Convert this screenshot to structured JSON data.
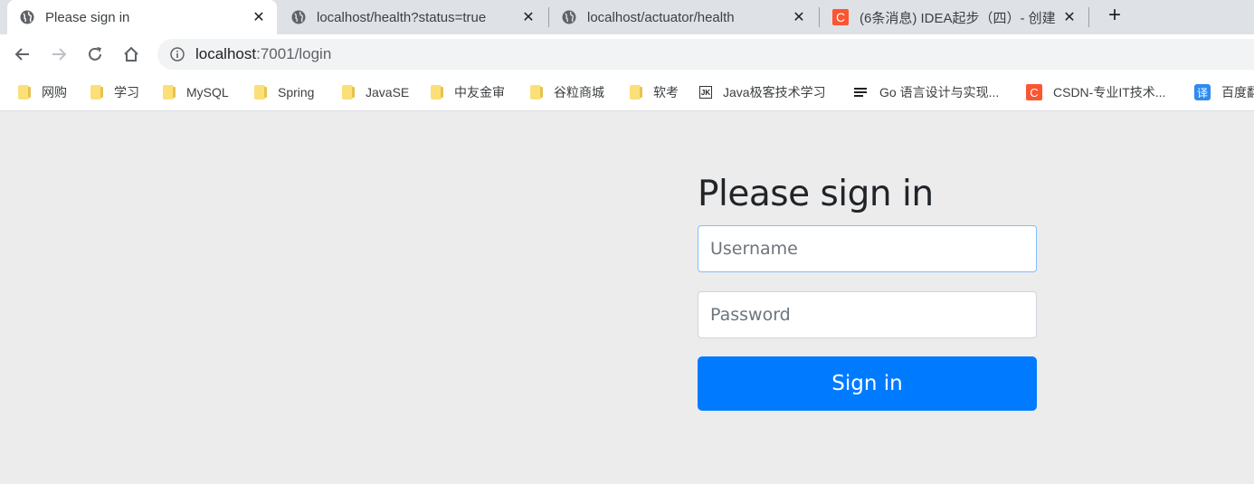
{
  "browser": {
    "tabs": [
      {
        "title": "Please sign in",
        "active": true,
        "icon": "globe-icon"
      },
      {
        "title": "localhost/health?status=true",
        "active": false,
        "icon": "globe-icon"
      },
      {
        "title": "localhost/actuator/health",
        "active": false,
        "icon": "globe-icon"
      },
      {
        "title": "(6条消息) IDEA起步（四）- 创建",
        "active": false,
        "icon": "csdn-icon"
      }
    ],
    "close_glyph": "✕",
    "new_tab_glyph": "+",
    "address": {
      "host": "localhost",
      "rest": ":7001/login"
    },
    "bookmarks": [
      {
        "label": "网购",
        "icon": "folder-icon"
      },
      {
        "label": "学习",
        "icon": "folder-icon"
      },
      {
        "label": "MySQL",
        "icon": "folder-icon"
      },
      {
        "label": "Spring",
        "icon": "folder-icon"
      },
      {
        "label": "JavaSE",
        "icon": "folder-icon"
      },
      {
        "label": "中友金审",
        "icon": "folder-icon"
      },
      {
        "label": "谷粒商城",
        "icon": "folder-icon"
      },
      {
        "label": "软考",
        "icon": "folder-icon"
      },
      {
        "label": "Java极客技术学习",
        "icon": "jk-icon"
      },
      {
        "label": "Go 语言设计与实现...",
        "icon": "lines-icon"
      },
      {
        "label": "CSDN-专业IT技术...",
        "icon": "csdn-icon"
      },
      {
        "label": "百度翻",
        "icon": "translate-icon"
      }
    ],
    "icon_text": {
      "csdn": "C",
      "jk": "JK",
      "translate": "译"
    }
  },
  "login": {
    "heading": "Please sign in",
    "username_placeholder": "Username",
    "password_placeholder": "Password",
    "submit_label": "Sign in"
  },
  "colors": {
    "primary": "#007bff",
    "focus_border": "#80bdff",
    "csdn_red": "#fc5531"
  }
}
